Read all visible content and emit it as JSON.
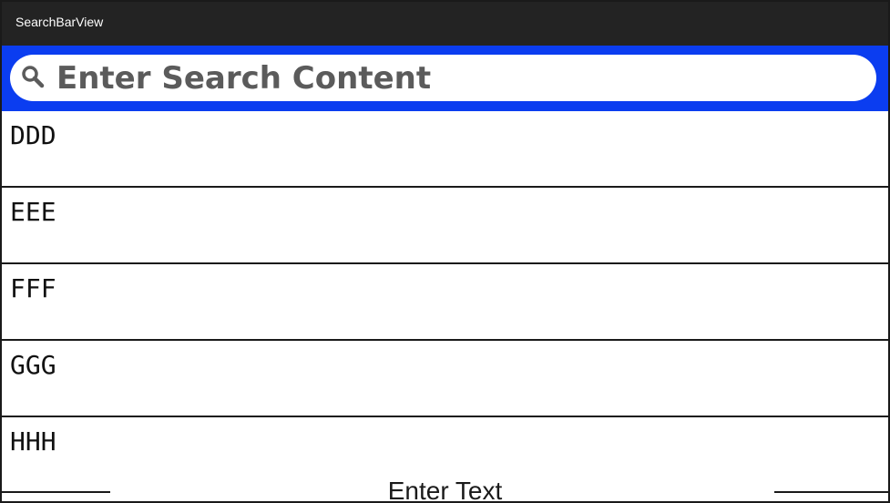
{
  "app": {
    "title": "SearchBarView"
  },
  "search": {
    "placeholder": "Enter Search Content",
    "icon": "search-icon",
    "band_color": "#0b3df0"
  },
  "list": {
    "items": [
      {
        "label": "DDD"
      },
      {
        "label": "EEE"
      },
      {
        "label": "FFF"
      },
      {
        "label": "GGG"
      },
      {
        "label": "HHH"
      }
    ]
  },
  "bottom_input": {
    "placeholder": "Enter Text"
  }
}
